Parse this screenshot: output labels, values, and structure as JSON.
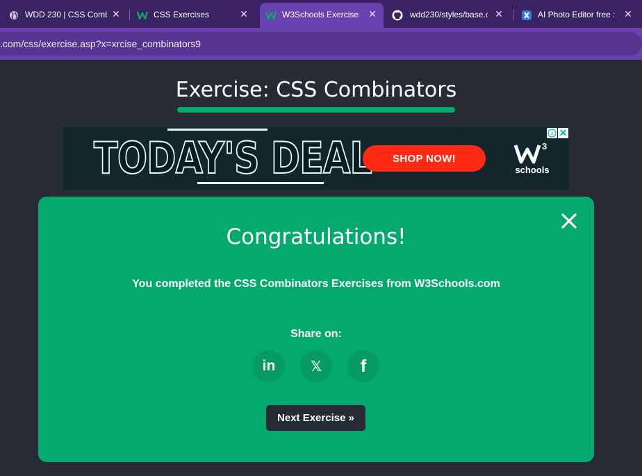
{
  "browser": {
    "tabs": [
      {
        "label": "WDD 230 | CSS Comb",
        "icon": "globe-icon",
        "active": false
      },
      {
        "label": "CSS Exercises",
        "icon": "w3schools-icon",
        "active": false
      },
      {
        "label": "W3Schools Exercise",
        "icon": "w3schools-icon",
        "active": true
      },
      {
        "label": "wdd230/styles/base.c",
        "icon": "github-icon",
        "active": false
      },
      {
        "label": "AI Photo Editor free :",
        "icon": "photo-editor-icon",
        "active": false
      }
    ],
    "close_glyph": "✕",
    "url": ".com/css/exercise.asp?x=xrcise_combinators9",
    "colors": {
      "tabstrip": "#3b2263",
      "active_tab": "#6a42b0",
      "address_bar": "#6a42b0"
    }
  },
  "page": {
    "title": "Exercise: CSS Combinators",
    "accent": "#04aa6d",
    "background": "#282a35"
  },
  "ad": {
    "headline": "TODAY'S DEAL",
    "cta": "SHOP NOW!",
    "logo_sup": "3",
    "logo_text": "schools",
    "close_glyph": "✕",
    "colors": {
      "cta": "#ff2a14",
      "background": "#0c1c22"
    }
  },
  "modal": {
    "title": "Congratulations!",
    "message": "You completed the CSS Combinators Exercises from W3Schools.com",
    "share_label": "Share on:",
    "share": [
      {
        "network": "linkedin",
        "label": "in",
        "icon": "linkedin-icon"
      },
      {
        "network": "x",
        "label": "𝕏",
        "icon": "x-icon"
      },
      {
        "network": "facebook",
        "label": "f",
        "icon": "facebook-icon"
      }
    ],
    "next_button": "Next Exercise »",
    "close_icon": "close-icon",
    "colors": {
      "background": "#04aa6d",
      "share_button": "#089a63",
      "next_button": "#282a35"
    }
  }
}
